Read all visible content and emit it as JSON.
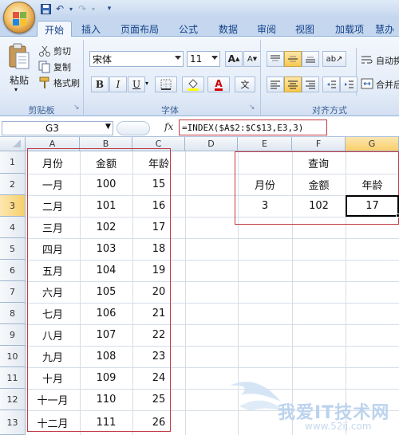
{
  "ribbon": {
    "tabs": [
      "开始",
      "插入",
      "页面布局",
      "公式",
      "数据",
      "审阅",
      "视图",
      "加载项",
      "慧办"
    ],
    "clipboard": {
      "paste": "粘贴",
      "cut": "剪切",
      "copy": "复制",
      "format_painter": "格式刷",
      "group_label": "剪贴板"
    },
    "font": {
      "name": "宋体",
      "size": "11",
      "bold": "B",
      "italic": "I",
      "underline": "U",
      "grow": "A",
      "shrink": "A",
      "font_color": "A",
      "phonetic": "文",
      "group_label": "字体"
    },
    "alignment": {
      "wrap": "自动换",
      "merge": "合并后",
      "group_label": "对齐方式"
    }
  },
  "formula_bar": {
    "name_box": "G3",
    "fx": "fx",
    "formula": "=INDEX($A$2:$C$13,E3,3)"
  },
  "sheet": {
    "columns": [
      "A",
      "B",
      "C",
      "D",
      "E",
      "F",
      "G"
    ],
    "rows": [
      "1",
      "2",
      "3",
      "4",
      "5",
      "6",
      "7",
      "8",
      "9",
      "10",
      "11",
      "12",
      "13"
    ],
    "table_header": [
      "月份",
      "金额",
      "年龄"
    ],
    "table_rows": [
      [
        "一月",
        "100",
        "15"
      ],
      [
        "二月",
        "101",
        "16"
      ],
      [
        "三月",
        "102",
        "17"
      ],
      [
        "四月",
        "103",
        "18"
      ],
      [
        "五月",
        "104",
        "19"
      ],
      [
        "六月",
        "105",
        "20"
      ],
      [
        "七月",
        "106",
        "21"
      ],
      [
        "八月",
        "107",
        "22"
      ],
      [
        "九月",
        "108",
        "23"
      ],
      [
        "十月",
        "109",
        "24"
      ],
      [
        "十一月",
        "110",
        "25"
      ],
      [
        "十二月",
        "111",
        "26"
      ]
    ],
    "query": {
      "title": "查询",
      "header": [
        "月份",
        "金额",
        "年龄"
      ],
      "values": [
        "3",
        "102",
        "17"
      ]
    },
    "selected_cell": "G3"
  },
  "watermark": {
    "text": "我爱IT技术网",
    "url": "www.52ij.com"
  },
  "colors": {
    "accent_red": "#c23a44",
    "ribbon_blue": "#15428b"
  }
}
